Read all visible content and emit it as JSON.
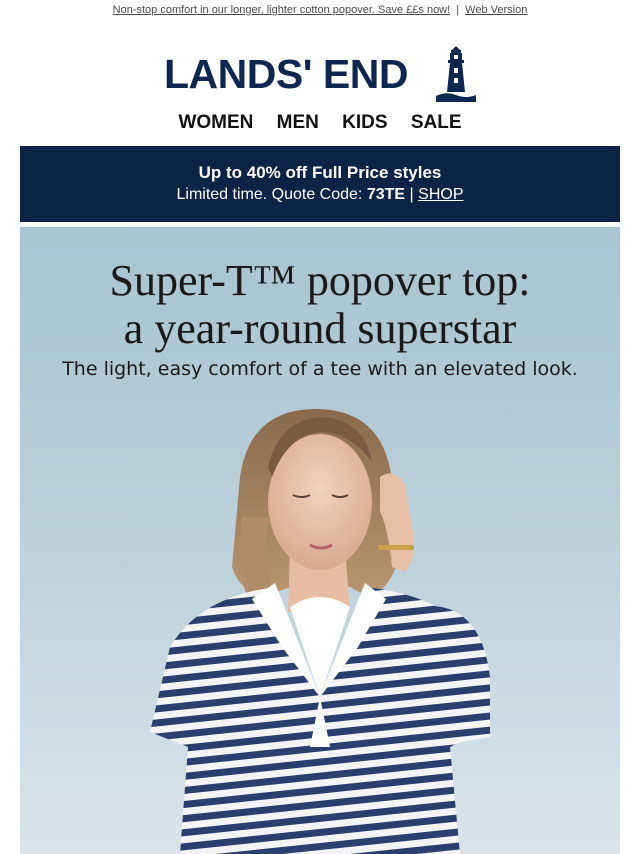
{
  "preheader": {
    "message": "Non-stop comfort in our longer, lighter cotton popover. Save ££s now!",
    "separator": "|",
    "web_version": "Web Version"
  },
  "brand": {
    "logo_text": "LANDS' END",
    "logo_icon": "lighthouse-icon",
    "brand_color": "#0d2750"
  },
  "nav": {
    "items": [
      "WOMEN",
      "MEN",
      "KIDS",
      "SALE"
    ]
  },
  "promo": {
    "headline": "Up to 40% off Full Price styles",
    "line_prefix": "Limited time. Quote Code:",
    "code": "73TE",
    "separator": "|",
    "cta": "SHOP",
    "background_color": "#0d2345"
  },
  "hero": {
    "title_line1": "Super-T™ popover top:",
    "title_line2": "a year-round superstar",
    "subtitle": "The light, easy comfort of a tee with an elevated look.",
    "image_subject": "woman-in-navy-white-striped-popover-top",
    "colors": {
      "sky": "#b9cfda",
      "stripe": "#2b3f6e",
      "collar": "#ffffff"
    }
  }
}
